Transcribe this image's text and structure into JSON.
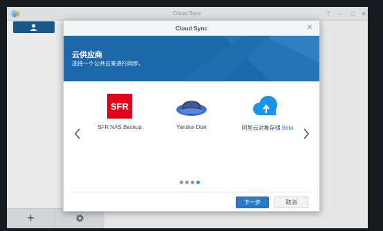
{
  "app": {
    "title": "Cloud Sync",
    "logo_icon": "cloud-sync-logo",
    "controls": [
      "pin-icon",
      "minimize-icon",
      "maximize-icon",
      "close-icon"
    ],
    "add_connection_icon": "user-icon",
    "footer": {
      "add_symbol": "+",
      "settings_icon": "gear-icon"
    }
  },
  "dialog": {
    "title": "Cloud Sync",
    "close_symbol": "✕",
    "banner": {
      "title": "云供应商",
      "subtitle": "选择一个公共云来进行同步。",
      "color": "#1c68ab"
    },
    "providers": [
      {
        "name": "SFR NAS Backup",
        "icon": "sfr-logo",
        "beta": ""
      },
      {
        "name": "Yandex Disk",
        "icon": "yandex-disk-logo",
        "beta": ""
      },
      {
        "name": "阿里云对象存储",
        "icon": "aliyun-oss-logo",
        "beta": "Beta"
      }
    ],
    "pagination": {
      "pages": 4,
      "active_page": 4
    },
    "buttons": {
      "next": "下一步",
      "cancel": "取消"
    }
  },
  "colors": {
    "accent": "#2a79c8",
    "sfr_red": "#e2001a",
    "yandex_blue": "#3c6fd1",
    "oss_blue": "#1a94e8"
  }
}
